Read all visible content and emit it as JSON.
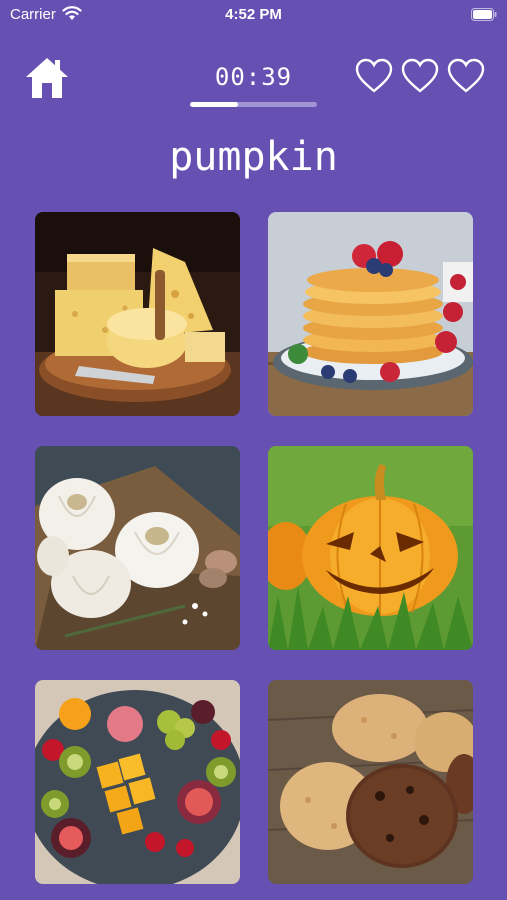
{
  "status_bar": {
    "carrier": "Carrier",
    "time": "4:52 PM"
  },
  "header": {
    "timer": "00:39",
    "timer_progress": 0.38,
    "lives": 3,
    "home_icon": "home-icon",
    "life_icon": "heart-outline-icon"
  },
  "prompt_word": "pumpkin",
  "choices": [
    {
      "subject": "cheese"
    },
    {
      "subject": "pancakes with berries"
    },
    {
      "subject": "garlic"
    },
    {
      "subject": "jack-o-lantern pumpkin"
    },
    {
      "subject": "fruit platter"
    },
    {
      "subject": "cookies"
    }
  ],
  "colors": {
    "background": "#6651b3",
    "progress_track": "#a195d6",
    "foreground": "#ffffff"
  }
}
